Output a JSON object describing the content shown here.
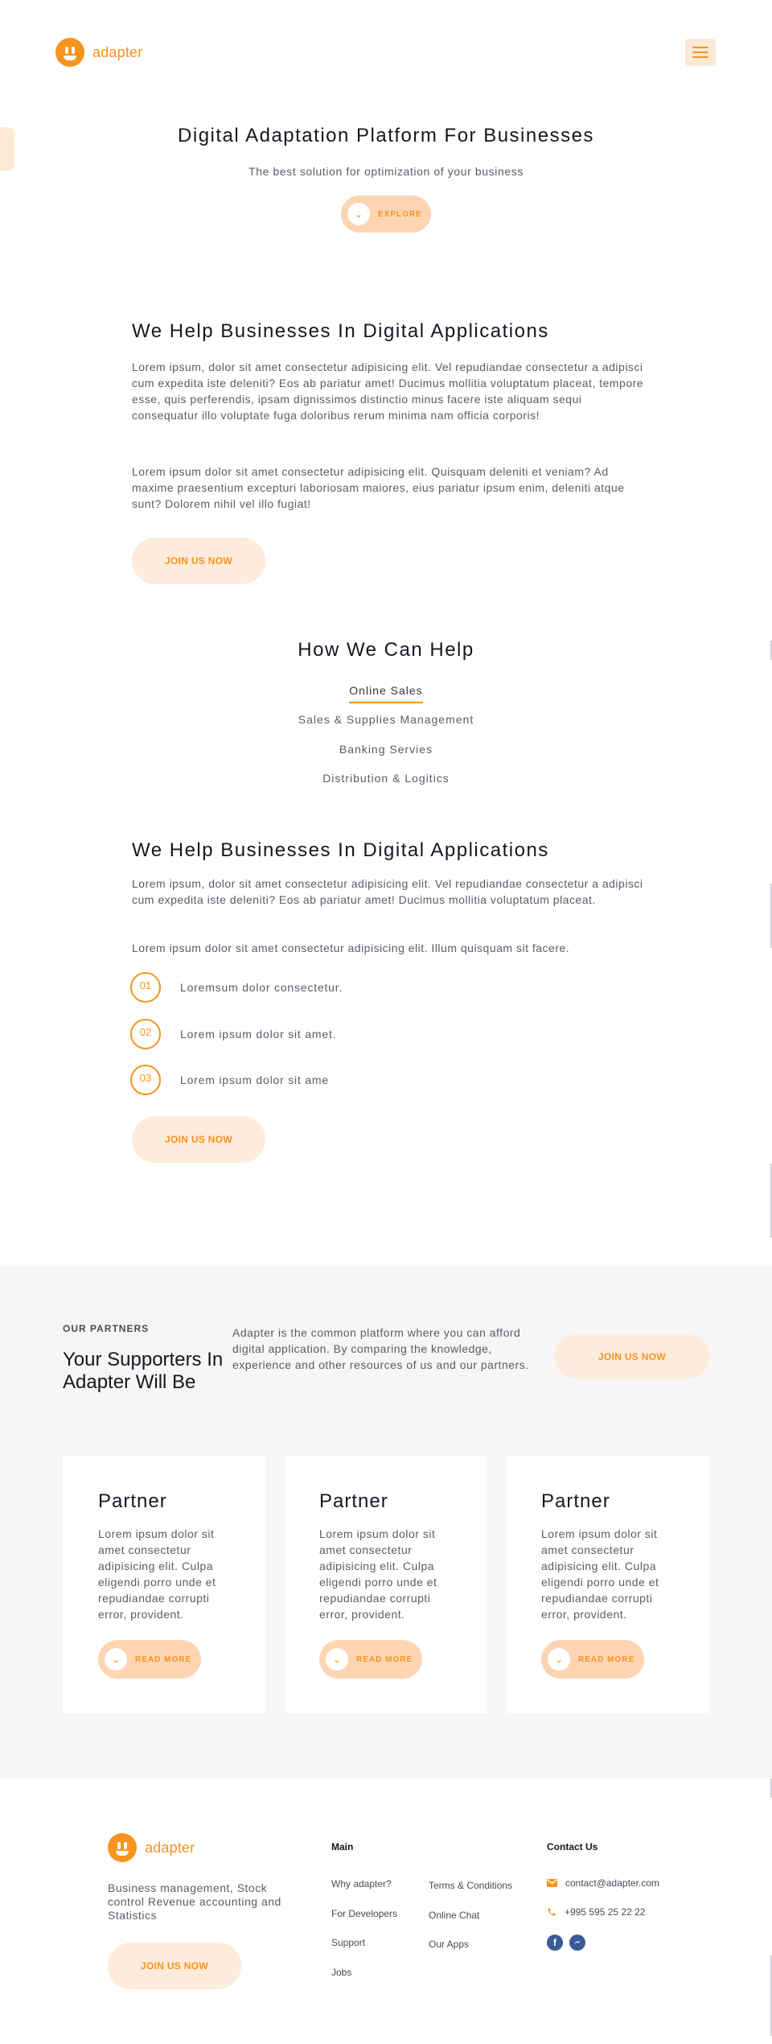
{
  "header": {
    "brand": "adapter"
  },
  "hero": {
    "title": "Digital Adaptation Platform For Businesses",
    "subtitle": "The best solution for optimization of your business",
    "cta": "EXPLORE"
  },
  "section1": {
    "title": "We Help Businesses In Digital Applications",
    "para1": "Lorem ipsum, dolor sit amet consectetur adipisicing elit. Vel repudiandae consectetur a adipisci cum expedita iste deleniti? Eos ab pariatur amet! Ducimus mollitia voluptatum placeat, tempore esse, quis perferendis, ipsam dignissimos distinctio minus facere iste aliquam sequi consequatur illo voluptate fuga doloribus rerum minima nam officia corporis!",
    "para2": "Lorem ipsum dolor sit amet consectetur adipisicing elit. Quisquam deleniti et veniam? Ad maxime praesentium excepturi laboriosam maiores, eius pariatur ipsum enim, deleniti atque sunt? Dolorem nihil vel illo fugiat!",
    "cta": "JOIN US NOW"
  },
  "help": {
    "title": "How We Can Help",
    "items": [
      "Online Sales",
      "Sales & Supplies Management",
      "Banking Servies",
      "Distribution & Logitics"
    ]
  },
  "section2": {
    "title": "We Help Businesses In Digital Applications",
    "para1": "Lorem ipsum, dolor sit amet consectetur adipisicing elit. Vel repudiandae consectetur a adipisci cum expedita iste deleniti? Eos ab pariatur amet! Ducimus mollitia voluptatum placeat.",
    "para2": "Lorem ipsum dolor sit amet consectetur adipisicing elit. Illum quisquam sit facere.",
    "list": [
      {
        "num": "01",
        "text": "Loremsum dolor consectetur."
      },
      {
        "num": "02",
        "text": "Lorem ipsum dolor sit amet."
      },
      {
        "num": "03",
        "text": "Lorem ipsum dolor sit ame"
      }
    ],
    "cta": "JOIN US NOW"
  },
  "partners": {
    "eyebrow": "OUR PARTNERS",
    "title": "Your Supporters In Adapter Will Be",
    "description": "Adapter is the common platform where you can afford digital application. By comparing the knowledge, experience and other resources of us and our partners.",
    "cta": "JOIN US NOW",
    "cards": [
      {
        "title": "Partner",
        "text": "Lorem ipsum dolor sit amet consectetur adipisicing elit. Culpa eligendi porro unde et repudiandae corrupti error, provident.",
        "cta": "READ MORE"
      },
      {
        "title": "Partner",
        "text": "Lorem ipsum dolor sit amet consectetur adipisicing elit. Culpa eligendi porro unde et repudiandae corrupti error, provident.",
        "cta": "READ MORE"
      },
      {
        "title": "Partner",
        "text": "Lorem ipsum dolor sit amet consectetur adipisicing elit. Culpa eligendi porro unde et repudiandae corrupti error, provident.",
        "cta": "READ MORE"
      }
    ]
  },
  "footer": {
    "brand": "adapter",
    "tagline": "Business management, Stock control Revenue accounting and Statistics",
    "cta": "JOIN US NOW",
    "main_heading": "Main",
    "links_col1": [
      "Why adapter?",
      "For Developers",
      "Support",
      "Jobs"
    ],
    "links_col2": [
      "Terms & Conditions",
      "Online Chat",
      "Our Apps"
    ],
    "contact_heading": "Contact Us",
    "email": "contact@adapter.com",
    "phone": "+995 595 25 22 22"
  },
  "colors": {
    "accent": "#f7931e",
    "accent_soft": "#fdebdb",
    "band_bg": "#f7f5f5"
  }
}
